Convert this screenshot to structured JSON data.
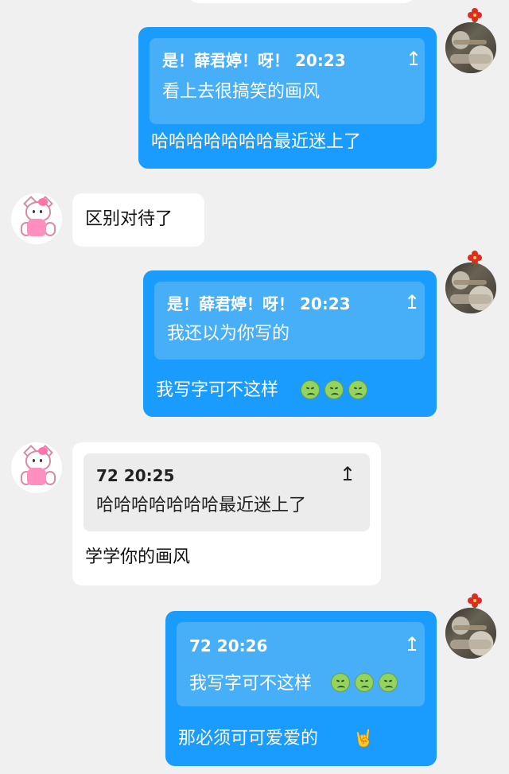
{
  "messages": [
    {
      "side": "right",
      "quote_meta": "是！薛君婷！呀！ 20:23",
      "quote_text": "看上去很搞笑的画风",
      "text": "哈哈哈哈哈哈哈最近迷上了"
    },
    {
      "side": "left",
      "text": "区别对待了"
    },
    {
      "side": "right",
      "quote_meta": "是！薛君婷！呀！ 20:23",
      "quote_text": "我还以为你写的",
      "text": "我写字可不这样"
    },
    {
      "side": "left",
      "quote_meta": "72 20:25",
      "quote_text": "哈哈哈哈哈哈哈最近迷上了",
      "text": "学学你的画风"
    },
    {
      "side": "right",
      "quote_meta": "72 20:26",
      "quote_text": "我写字可不这样",
      "text": "那必须可可爱爱的"
    }
  ],
  "icons": {
    "quote_arrow": "up-arrow-icon",
    "sad_emoji": "sad-frog-emoji",
    "rock_emoji": "rock-hand-emoji"
  },
  "glyphs": {
    "quote_arrow": "↥",
    "rock_emoji": "🤘"
  },
  "colors": {
    "background": "#f0f0f0",
    "self_bubble": "#1a9cff",
    "self_quote": "#47aef8",
    "other_bubble": "#ffffff",
    "other_quote": "#ececec"
  }
}
